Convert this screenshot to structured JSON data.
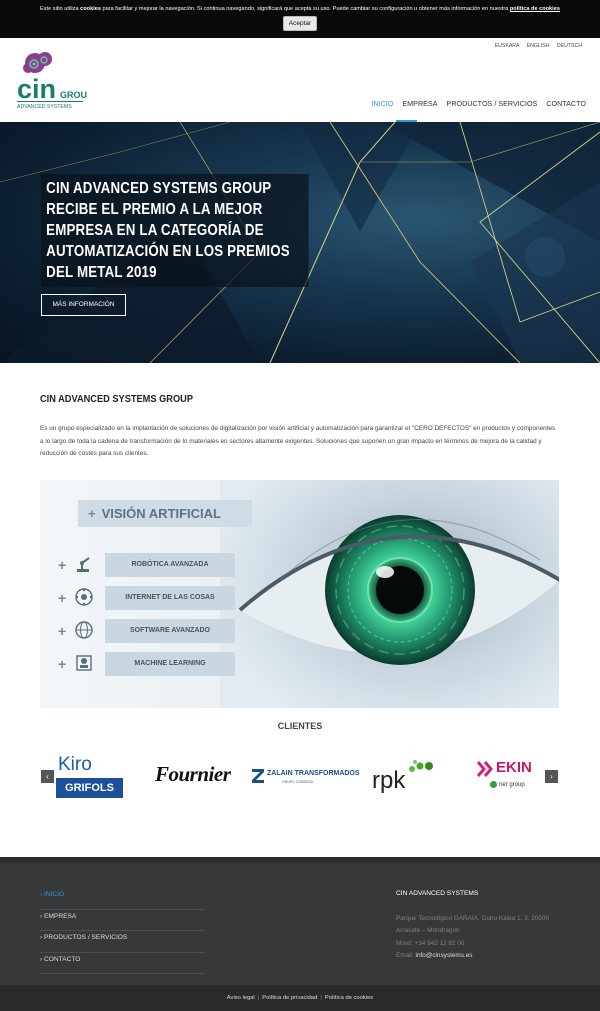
{
  "cookie": {
    "text_before": "Este sitio utiliza ",
    "text_bold": "cookies",
    "text_after": " para facilitar y mejorar la navegación. Si continua navegando, significará que acepta su uso. Puede cambiar su configuración u obtener más información en nuestra ",
    "link": "política de cookies",
    "accept_label": "Aceptar"
  },
  "languages": [
    "EUSKARA",
    "ENGLISH",
    "DEUTSCH"
  ],
  "logo": {
    "word": "cin",
    "group": "GROUP",
    "sub": "ADVANCED SYSTEMS"
  },
  "nav": [
    "INICIO",
    "EMPRESA",
    "PRODUCTOS / SERVICIOS",
    "CONTACTO"
  ],
  "hero": {
    "title": "CIN ADVANCED SYSTEMS GROUP RECIBE EL PREMIO A LA MEJOR EMPRESA EN LA CATEGORÍA DE AUTOMATIZACIÓN EN LOS PREMIOS DEL METAL 2019",
    "button": "MÁS INFORMACIÓN"
  },
  "intro": {
    "title": "CIN ADVANCED SYSTEMS GROUP",
    "text": "Es un grupo especializado en la implantación de soluciones de digitalización por visión artificial y automatización para garantizar el \"CERO DEFECTOS\" en productos y componentes a lo largo de toda la cadena de transformación de lo materiales en sectores altamente exigentes. Soluciones que suponen un gran impacto en términos de mejora de la calidad y reducción de costes para sus clientes."
  },
  "vision": {
    "title": "VISIÓN ARTIFICIAL",
    "items": [
      "ROBÓTICA AVANZADA",
      "INTERNET DE LAS COSAS",
      "SOFTWARE AVANZADO",
      "MACHINE LEARNING"
    ]
  },
  "clients": {
    "title": "CLIENTES",
    "logos": {
      "kiro_top": "Kiro",
      "kiro_bottom": "GRIFOLS",
      "fournier": "Fournier",
      "zalain": "ZALAIN TRANSFORMADOS",
      "zalain_sub": "GRUPO CONDESA",
      "rpk": "rpk",
      "ekin": "EKIN",
      "ekin_sub": "ner group"
    }
  },
  "footer": {
    "nav": [
      "INICIO",
      "EMPRESA",
      "PRODUCTOS / SERVICIOS",
      "CONTACTO"
    ],
    "company": "CIN ADVANCED SYSTEMS",
    "address1": "Parque Tecnológico GARAIA, Goiru Kalea 1, 3, 20500",
    "address2": "Arrasate – Mondragón",
    "phone": "Móvil: +34 943 12 82 00",
    "email_label": "Email: ",
    "email": "info@cinsystems.es"
  },
  "bottom": [
    "Aviso legal",
    "Política de privacidad",
    "Política de cookies"
  ],
  "colors": {
    "accent": "#2a9fd6",
    "footer": "#363839"
  }
}
